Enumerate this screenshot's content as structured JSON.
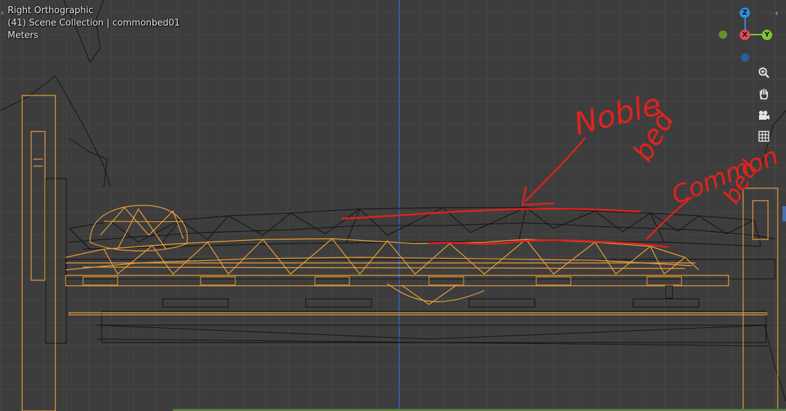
{
  "viewport": {
    "view_name": "Right Orthographic",
    "collection_info": "(41) Scene Collection | commonbed01",
    "units": "Meters"
  },
  "gizmo": {
    "z_label": "Z",
    "x_label": "X",
    "y_label": "Y",
    "colors": {
      "z": "#2e8fe0",
      "x": "#e84a5a",
      "y": "#7dc832",
      "neg_y": "#6a8f2a",
      "neg_z": "#2a5f9f"
    }
  },
  "nav_tools": [
    {
      "icon": "zoom-icon"
    },
    {
      "icon": "hand-pan-icon"
    },
    {
      "icon": "camera-icon"
    },
    {
      "icon": "grid-icon"
    }
  ],
  "annotations": {
    "upper_first": "Noble",
    "upper_second": "bed",
    "lower_first": "Common",
    "lower_second": "bed",
    "color": "#e0231c"
  },
  "colors": {
    "background": "#3d3d3d",
    "grid": "#464646",
    "selected_wire": "#f0a238",
    "unselected_wire": "#111111",
    "axis_line": "#2e63b8"
  }
}
